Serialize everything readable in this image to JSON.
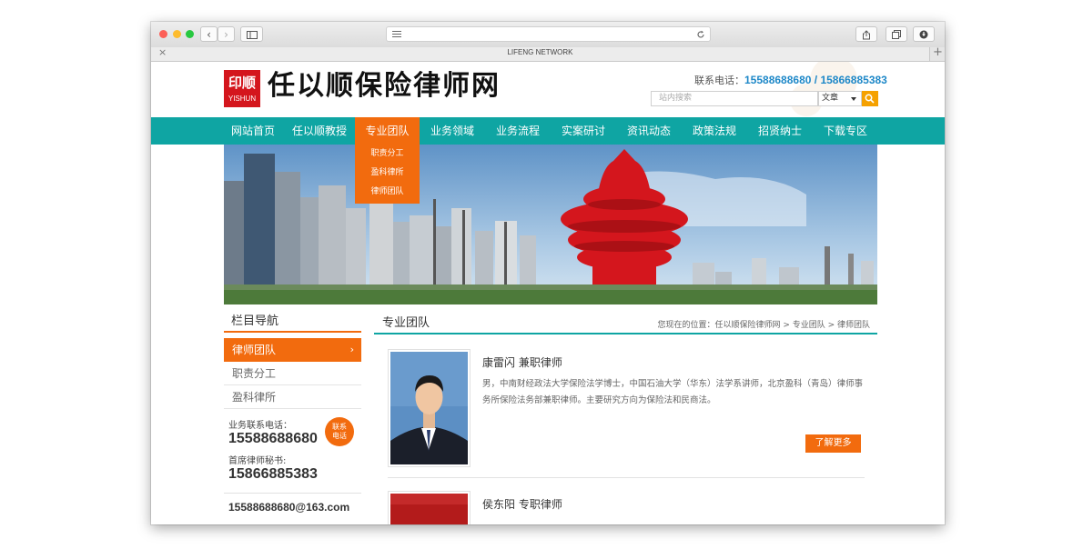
{
  "browser": {
    "tab_title": "LIFENG NETWORK",
    "tab_close": "×",
    "new_tab": "+",
    "back": "‹",
    "forward": "›"
  },
  "header": {
    "logo_cn": "印顺",
    "logo_en": "YISHUN",
    "site_title": "任以顺保险律师网",
    "phone_label": "联系电话：",
    "phone_1": "15588688680",
    "phone_sep": " / ",
    "phone_2": "15866885383",
    "search_placeholder": "站内搜索",
    "search_select": "文章"
  },
  "nav": {
    "items": [
      "网站首页",
      "任以顺教授",
      "专业团队",
      "业务领域",
      "业务流程",
      "实案研讨",
      "资讯动态",
      "政策法规",
      "招贤纳士",
      "下载专区"
    ],
    "dropdown": [
      "职责分工",
      "盈科律所",
      "律师团队"
    ]
  },
  "sidebar": {
    "title": "栏目导航",
    "items": [
      "律师团队",
      "职责分工",
      "盈科律所"
    ],
    "active_arrow": "›",
    "contact_label_1": "业务联系电话：",
    "contact_phone_1": "15588688680",
    "contact_label_2": "首席律师秘书:",
    "contact_phone_2": "15866885383",
    "bubble_line1": "联系",
    "bubble_line2": "电话",
    "email": "15588688680@163.com"
  },
  "main": {
    "title": "专业团队",
    "breadcrumb": "您现在的位置：任以顺保险律师网 > 专业团队 > 律师团队",
    "cards": [
      {
        "name": "康雷闪 兼职律师",
        "desc": "男，中南财经政法大学保险法学博士，中国石油大学（华东）法学系讲师，北京盈科（青岛）律师事务所保险法务部兼职律师。主要研究方向为保险法和民商法。",
        "more": "了解更多"
      },
      {
        "name": "侯东阳 专职律师"
      }
    ]
  },
  "colors": {
    "teal": "#0fa5a3",
    "orange": "#f26b0e",
    "brand_red": "#d4161d",
    "phone_blue": "#1e88c8"
  }
}
